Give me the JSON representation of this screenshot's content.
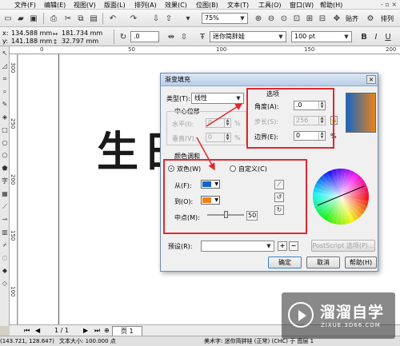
{
  "menu": {
    "items": [
      "文件(F)",
      "编辑(E)",
      "视图(V)",
      "版面(L)",
      "排列(A)",
      "效果(C)",
      "位图(B)",
      "文本(T)",
      "工具(O)",
      "窗口(W)",
      "帮助(H)"
    ]
  },
  "toolbar": {
    "zoom_value": "75%",
    "snap_label": "贴齐",
    "right_label": "排列"
  },
  "propbar": {
    "x_label": "x:",
    "x_value": "134.588 mm",
    "y_label": "y:",
    "y_value": "141.188 mm",
    "w_value": "181.734 mm",
    "h_value": "32.797 mm",
    "rotation_value": ".0",
    "font_name": "迷你简胖娃",
    "font_size": "100 pt"
  },
  "ruler": {
    "h_ticks": [
      "0",
      "50",
      "100",
      "150",
      "200"
    ],
    "v_ticks": [
      "300",
      "250",
      "200",
      "150",
      "100"
    ]
  },
  "canvas": {
    "text": "生日"
  },
  "page_nav": {
    "counter": "1 / 1",
    "tab_label": "页 1"
  },
  "status": {
    "coords": "(143.721, 128.647)",
    "info": "文本大小: 100.000 点",
    "font_info": "美术字: 迷你简胖娃 (正常) (CHC) 于 图层 1"
  },
  "dialog": {
    "title": "渐变填充",
    "close": "×",
    "type_label": "类型(T):",
    "type_value": "线性",
    "center_offset_label": "中心位移",
    "horizontal_label": "水平(I):",
    "horizontal_value": "0",
    "vertical_label": "垂直(V):",
    "vertical_value": "0",
    "percent": "%",
    "options_label": "选项",
    "angle_label": "角度(A):",
    "angle_value": ".0",
    "steps_label": "步长(S):",
    "steps_value": "256",
    "edge_pad_label": "边界(E):",
    "edge_pad_value": "0",
    "blend_label": "颜色调和",
    "two_color_label": "双色(W)",
    "custom_label": "自定义(C)",
    "from_label": "从(F):",
    "to_label": "到(O):",
    "midpoint_label": "中点(M):",
    "midpoint_value": "50",
    "presets_label": "预设(R):",
    "postscript_label": "PostScript 选项(P)...",
    "ok_label": "确定",
    "cancel_label": "取消",
    "help_label": "帮助(H)",
    "from_color": "#1565c8",
    "to_color": "#e88417",
    "accent_color": "#e0282d"
  },
  "watermark": {
    "name": "溜溜自学",
    "url": "ZIXUE.3D66.COM"
  }
}
